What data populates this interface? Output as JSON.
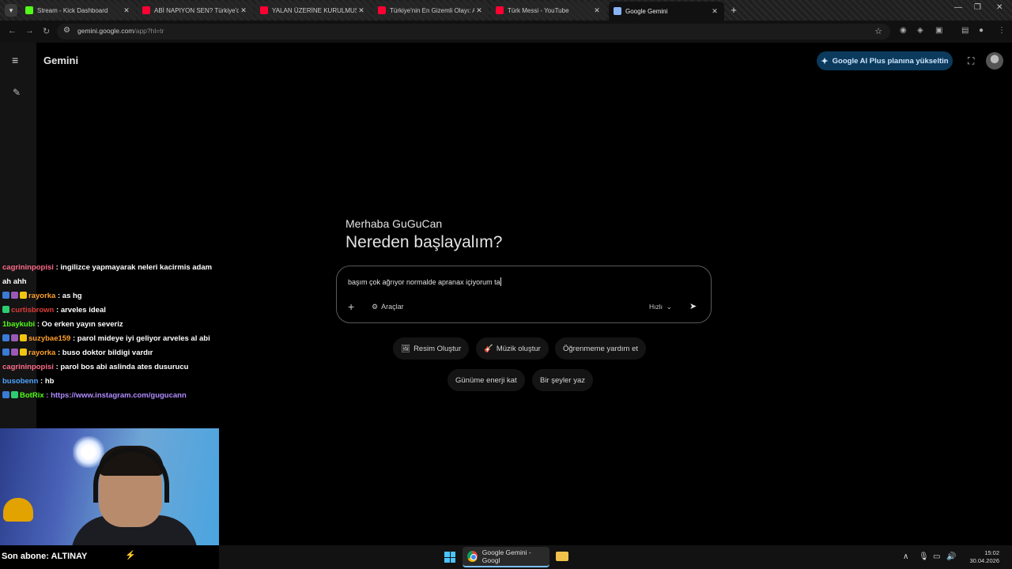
{
  "browser": {
    "tabs": [
      {
        "title": "Stream - Kick Dashboard",
        "favicon_color": "#53fc18",
        "active": false
      },
      {
        "title": "ABİ NAPIYON SEN? Türkiye'de",
        "favicon_color": "#ff0033",
        "active": false
      },
      {
        "title": "YALAN ÜZERİNE KURULMUŞ K",
        "favicon_color": "#ff0033",
        "active": false
      },
      {
        "title": "Türkiye'nin En Gizemli Olayı: Al",
        "favicon_color": "#ff0033",
        "active": false
      },
      {
        "title": "Türk Messi - YouTube",
        "favicon_color": "#ff0033",
        "active": false
      },
      {
        "title": "Google Gemini",
        "favicon_color": "#8ab4f8",
        "active": true
      }
    ],
    "close_glyph": "✕",
    "new_tab_glyph": "+",
    "url_host": "gemini.google.com",
    "url_path": "/app?hl=tr"
  },
  "gemini": {
    "brand": "Gemini",
    "upgrade_label": "Google AI Plus planına yükseltin",
    "greeting": "Merhaba GuGuCan",
    "headline": "Nereden başlayalım?",
    "prompt_text": "başım çok ağrıyor normalde apranax içiyorum ta",
    "tools_label": "Araçlar",
    "model_label": "Hızlı",
    "chips": [
      {
        "label": "Resim Oluştur",
        "icon": "🖼"
      },
      {
        "label": "Müzik oluştur",
        "icon": "🎸"
      },
      {
        "label": "Öğrenmeme yardım et",
        "icon": ""
      },
      {
        "label": "Günüme enerji kat",
        "icon": ""
      },
      {
        "label": "Bir şeyler yaz",
        "icon": ""
      }
    ]
  },
  "chat": {
    "messages": [
      {
        "user": "cagrininpopisi",
        "user_color": "#ff6b8a",
        "badges": [],
        "text": ": ingilizce yapmayarak neleri kacirmis adam ah ahh"
      },
      {
        "user": "rayorka",
        "user_color": "#ff9f2e",
        "badges": [
          "#3a7bd5",
          "#9b59b6",
          "#f1c40f"
        ],
        "text": ": as hg"
      },
      {
        "user": "curtisbrown",
        "user_color": "#e03a3a",
        "badges": [
          "#2ecc71"
        ],
        "text": ": arveles ideal"
      },
      {
        "user": "1baykubi",
        "user_color": "#53fc18",
        "badges": [],
        "text": ": Oo erken yayın severiz"
      },
      {
        "user": "suzybae159",
        "user_color": "#ff9f2e",
        "badges": [
          "#3a7bd5",
          "#9b59b6",
          "#f1c40f"
        ],
        "text": ": parol mideye iyi geliyor arveles al abi"
      },
      {
        "user": "rayorka",
        "user_color": "#ff9f2e",
        "badges": [
          "#3a7bd5",
          "#9b59b6",
          "#f1c40f"
        ],
        "text": ": buso doktor bildigi vardır"
      },
      {
        "user": "cagrininpopisi",
        "user_color": "#ff6b8a",
        "badges": [],
        "text": ": parol bos abi aslinda ates dusurucu"
      },
      {
        "user": "busobenn",
        "user_color": "#4fa3ff",
        "badges": [],
        "text": ": hb"
      },
      {
        "user": "BotRix",
        "user_color": "#53fc18",
        "badges": [
          "#3a7bd5",
          "#2ecc71"
        ],
        "text": ": https://www.instagram.com/gugucann",
        "text_color": "#b08cff"
      }
    ]
  },
  "overlay": {
    "sub_label": "Son abone: ALTINAY"
  },
  "taskbar": {
    "app_label": "Google Gemini - Googl",
    "time": "15:02",
    "date": "30.04.2026"
  }
}
